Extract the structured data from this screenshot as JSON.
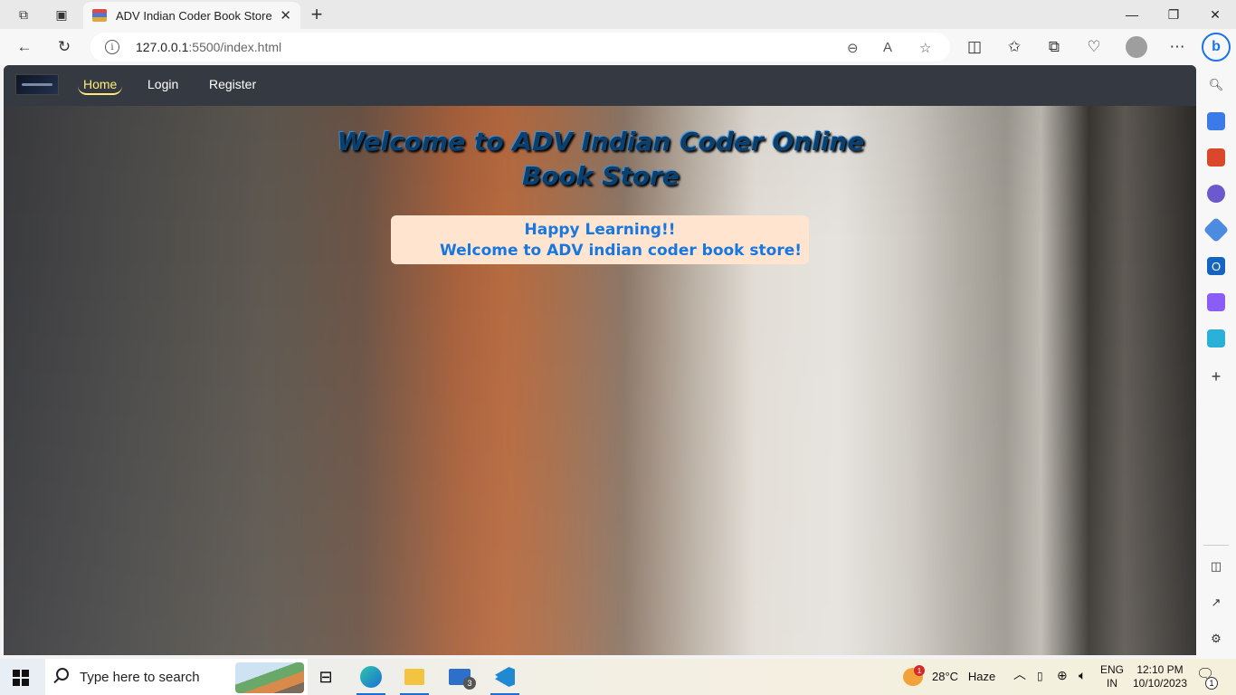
{
  "browser": {
    "tab_title": "ADV Indian Coder Book Store",
    "url_host": "127.0.0.1",
    "url_path": ":5500/index.html"
  },
  "navbar": {
    "links": [
      "Home",
      "Login",
      "Register"
    ]
  },
  "hero": {
    "title": "Welcome to ADV Indian Coder Online Book Store"
  },
  "welcome_box": {
    "line1": "Happy Learning!!",
    "line2": "Welcome to ADV indian coder book store!"
  },
  "taskbar": {
    "search_placeholder": "Type here to search",
    "mail_badge": "3",
    "weather_temp": "28°C",
    "weather_desc": "Haze",
    "weather_alert": "1",
    "lang_1": "ENG",
    "lang_2": "IN",
    "time": "12:10 PM",
    "date": "10/10/2023",
    "notification_count": "1"
  },
  "colors": {
    "navbar_bg": "#353a42",
    "nav_active": "#ffeb7a",
    "title_color": "#0a3f6e",
    "box_bg": "#ffe5cf",
    "box_text": "#1877e0"
  }
}
